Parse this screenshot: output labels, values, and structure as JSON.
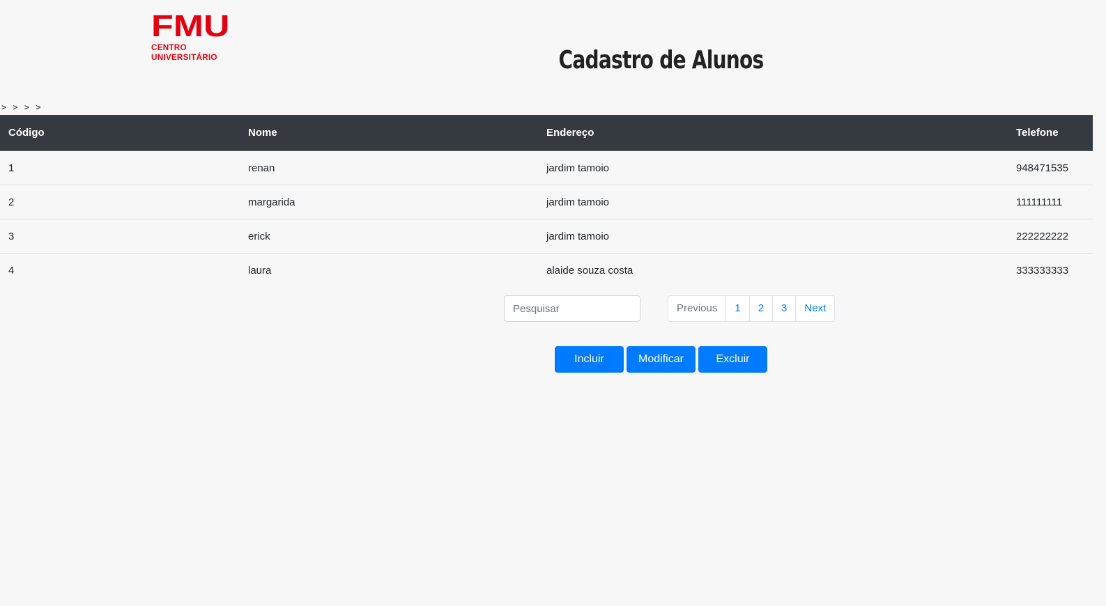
{
  "logo": {
    "main": "FMU",
    "sub": "CENTRO UNIVERSITÁRIO",
    "color": "#e3000f"
  },
  "page_title": "Cadastro de Alunos",
  "chevrons": "> > > >",
  "table": {
    "headers": [
      "Código",
      "Nome",
      "Endereço",
      "Telefone"
    ],
    "rows": [
      [
        "1",
        "renan",
        "jardim tamoio",
        "948471535"
      ],
      [
        "2",
        "margarida",
        "jardim tamoio",
        "111111111"
      ],
      [
        "3",
        "erick",
        "jardim tamoio",
        "222222222"
      ],
      [
        "4",
        "laura",
        "alaide souza costa",
        "333333333"
      ]
    ]
  },
  "search": {
    "placeholder": "Pesquisar",
    "value": ""
  },
  "pagination": {
    "previous": "Previous",
    "pages": [
      "1",
      "2",
      "3"
    ],
    "next": "Next"
  },
  "actions": {
    "incluir": "Incluir",
    "modificar": "Modificar",
    "excluir": "Excluir"
  },
  "colors": {
    "primary": "#007bff",
    "table_header_bg": "#343a40",
    "background": "#f7f7f7"
  }
}
